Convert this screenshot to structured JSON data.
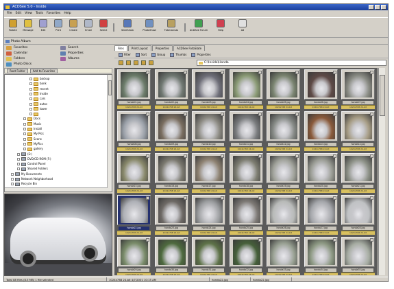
{
  "window": {
    "title": "ACDSee 5.0 - Inside"
  },
  "menu": [
    "File",
    "Edit",
    "View",
    "Tools",
    "Favorites",
    "Help"
  ],
  "toolbar": {
    "buttons": [
      {
        "label": "Rotate",
        "icon": "rotate-icon",
        "color": "#d0a030"
      },
      {
        "label": "Message",
        "icon": "message-icon",
        "color": "#e0c040"
      },
      {
        "label": "Edit",
        "icon": "edit-icon",
        "color": "#a0a0d0"
      },
      {
        "label": "Print",
        "icon": "print-icon",
        "color": "#90a8c8"
      },
      {
        "label": "Create",
        "icon": "create-icon",
        "color": "#c8a050"
      },
      {
        "label": "Email",
        "icon": "email-icon",
        "color": "#b0b8c8"
      },
      {
        "label": "Select",
        "icon": "select-icon",
        "color": "#d04040"
      }
    ],
    "buttons2": [
      {
        "label": "SlideShow",
        "icon": "slideshow-icon",
        "color": "#5878b8"
      },
      {
        "label": "PhotoShow",
        "icon": "photoshow-icon",
        "color": "#7090c0"
      },
      {
        "label": "FotoCanvas",
        "icon": "fotocanvas-icon",
        "color": "#b8a060"
      }
    ],
    "buttons3": [
      {
        "label": "ACDSee Forum",
        "icon": "forum-icon",
        "color": "#40a050"
      },
      {
        "label": "Help",
        "icon": "help-icon",
        "color": "#d04050"
      },
      {
        "label": "Ad",
        "icon": "ad-icon",
        "color": "#e0e0e0"
      }
    ]
  },
  "address": "Photo Album",
  "nav": {
    "items": [
      {
        "label": "Favorites",
        "color": "#d8a040"
      },
      {
        "label": "Search",
        "color": "#8080a0"
      },
      {
        "label": "Calendar",
        "color": "#d06040"
      },
      {
        "label": "Properties",
        "color": "#6080b0"
      },
      {
        "label": "Folders",
        "color": "#e0c050"
      },
      {
        "label": "Albums",
        "color": "#a060a0"
      },
      {
        "label": "Photo Discs",
        "color": "#5090c0"
      }
    ],
    "folder_tabs": [
      "Root Folder",
      "Add to Favorites"
    ]
  },
  "tree": {
    "nodes": [
      {
        "label": "backup",
        "indent": 4,
        "dark": false
      },
      {
        "label": "bank",
        "indent": 4,
        "dark": false
      },
      {
        "label": "recent",
        "indent": 4,
        "dark": false
      },
      {
        "label": "Inside",
        "indent": 4,
        "dark": false
      },
      {
        "label": "cars",
        "indent": 4,
        "dark": false
      },
      {
        "label": "autos",
        "indent": 4,
        "dark": false
      },
      {
        "label": "lower",
        "indent": 4,
        "dark": false
      },
      {
        "label": "",
        "indent": 4,
        "dark": false
      },
      {
        "label": "Docs",
        "indent": 3,
        "dark": false
      },
      {
        "label": "Music",
        "indent": 3,
        "dark": false
      },
      {
        "label": "Install",
        "indent": 3,
        "dark": false
      },
      {
        "label": "My Pics",
        "indent": 3,
        "dark": false
      },
      {
        "label": "Scans",
        "indent": 3,
        "dark": false
      },
      {
        "label": "MyPics",
        "indent": 3,
        "dark": false
      },
      {
        "label": "gallery",
        "indent": 3,
        "dark": false
      },
      {
        "label": "(E:)",
        "indent": 2,
        "dark": true
      },
      {
        "label": "DVD/CD-ROM (F:)",
        "indent": 2,
        "dark": true
      },
      {
        "label": "Control Panel",
        "indent": 2,
        "dark": true
      },
      {
        "label": "Shared Folders",
        "indent": 2,
        "dark": true
      },
      {
        "label": "My Documents",
        "indent": 1,
        "dark": true
      },
      {
        "label": "Network Neighborhood",
        "indent": 1,
        "dark": true
      },
      {
        "label": "Recycle Bin",
        "indent": 1,
        "dark": true
      },
      {
        "label": "Web",
        "indent": 1,
        "dark": false
      }
    ]
  },
  "browser": {
    "tabs": [
      "Files",
      "Print Layout",
      "Properties",
      "ACDSee FotoSlate"
    ],
    "toolbar1": [
      "Filter",
      "Sort",
      "Group",
      "Thumbs",
      "Properties"
    ],
    "path": "C:\\Inside\\Honda"
  },
  "thumbnails": [
    {
      "name": "honda01.jpg",
      "meta": "1024x768 24-bit",
      "color": "#6c7c6a"
    },
    {
      "name": "honda02.jpg",
      "meta": "1024x768 24-bit",
      "color": "#707872"
    },
    {
      "name": "honda03.jpg",
      "meta": "1024x768 24-bit",
      "color": "#6e6e78"
    },
    {
      "name": "honda04.jpg",
      "meta": "1024x768 24-bit",
      "color": "#8a9a74"
    },
    {
      "name": "honda05.jpg",
      "meta": "1024x768 24-bit",
      "color": "#7a8470"
    },
    {
      "name": "honda06.jpg",
      "meta": "1024x768 24-bit",
      "color": "#5e4a46"
    },
    {
      "name": "honda07.jpg",
      "meta": "1024x768 24-bit",
      "color": "#8a8c84"
    },
    {
      "name": "honda08.jpg",
      "meta": "1024x768 24-bit",
      "color": "#9aa0a8"
    },
    {
      "name": "honda09.jpg",
      "meta": "1024x768 24-bit",
      "color": "#7a6e60"
    },
    {
      "name": "honda10.jpg",
      "meta": "1024x768 24-bit",
      "color": "#8c8a82"
    },
    {
      "name": "honda11.jpg",
      "meta": "1024x768 24-bit",
      "color": "#7a7c7e"
    },
    {
      "name": "honda12.jpg",
      "meta": "1024x768 24-bit",
      "color": "#868a86"
    },
    {
      "name": "honda13.jpg",
      "meta": "1024x768 24-bit",
      "color": "#8a5a3a"
    },
    {
      "name": "honda14.jpg",
      "meta": "1024x768 24-bit",
      "color": "#a69c84"
    },
    {
      "name": "honda15.jpg",
      "meta": "1024x768 24-bit",
      "color": "#8a8a6c"
    },
    {
      "name": "honda16.jpg",
      "meta": "1024x768 24-bit",
      "color": "#7c7a70"
    },
    {
      "name": "honda17.jpg",
      "meta": "1024x768 24-bit",
      "color": "#8e8272"
    },
    {
      "name": "honda18.jpg",
      "meta": "1024x768 24-bit",
      "color": "#7e7e72"
    },
    {
      "name": "honda19.jpg",
      "meta": "1024x768 24-bit",
      "color": "#a0a29a"
    },
    {
      "name": "honda20.jpg",
      "meta": "1024x768 24-bit",
      "color": "#9a9c94"
    },
    {
      "name": "honda21.jpg",
      "meta": "1024x768 24-bit",
      "color": "#8c9086"
    },
    {
      "name": "honda22.jpg",
      "meta": "1024x768 24-bit",
      "color": "#aeb0b6",
      "selected": true
    },
    {
      "name": "honda23.jpg",
      "meta": "1024x768 24-bit",
      "color": "#6e6a66"
    },
    {
      "name": "honda24.jpg",
      "meta": "1024x768 24-bit",
      "color": "#9c9ea0"
    },
    {
      "name": "honda25.jpg",
      "meta": "1024x768 24-bit",
      "color": "#7e7a76"
    },
    {
      "name": "honda26.jpg",
      "meta": "1024x768 24-bit",
      "color": "#b8bab8"
    },
    {
      "name": "honda27.jpg",
      "meta": "1024x768 24-bit",
      "color": "#a4a6aa"
    },
    {
      "name": "honda28.jpg",
      "meta": "1024x768 24-bit",
      "color": "#c0c2c4"
    },
    {
      "name": "honda29.jpg",
      "meta": "1024x768 24-bit",
      "color": "#7a8c6a"
    },
    {
      "name": "honda30.jpg",
      "meta": "1024x768 24-bit",
      "color": "#4e6a3e"
    },
    {
      "name": "honda31.jpg",
      "meta": "1024x768 24-bit",
      "color": "#5e7248"
    },
    {
      "name": "honda32.jpg",
      "meta": "1024x768 24-bit",
      "color": "#46603a"
    },
    {
      "name": "honda33.jpg",
      "meta": "1024x768 24-bit",
      "color": "#98a092"
    },
    {
      "name": "honda34.jpg",
      "meta": "1024x768 24-bit",
      "color": "#8e9a84"
    },
    {
      "name": "honda35.jpg",
      "meta": "1024x768 24-bit",
      "color": "#a6aca2"
    }
  ],
  "status": {
    "segments": [
      "Total 88 files (8.5 MB) 1 file selected",
      "1024x768 24-bit 4/7/2001 10:15 AM",
      "honda22.jpg",
      "honda22.jpg"
    ]
  }
}
